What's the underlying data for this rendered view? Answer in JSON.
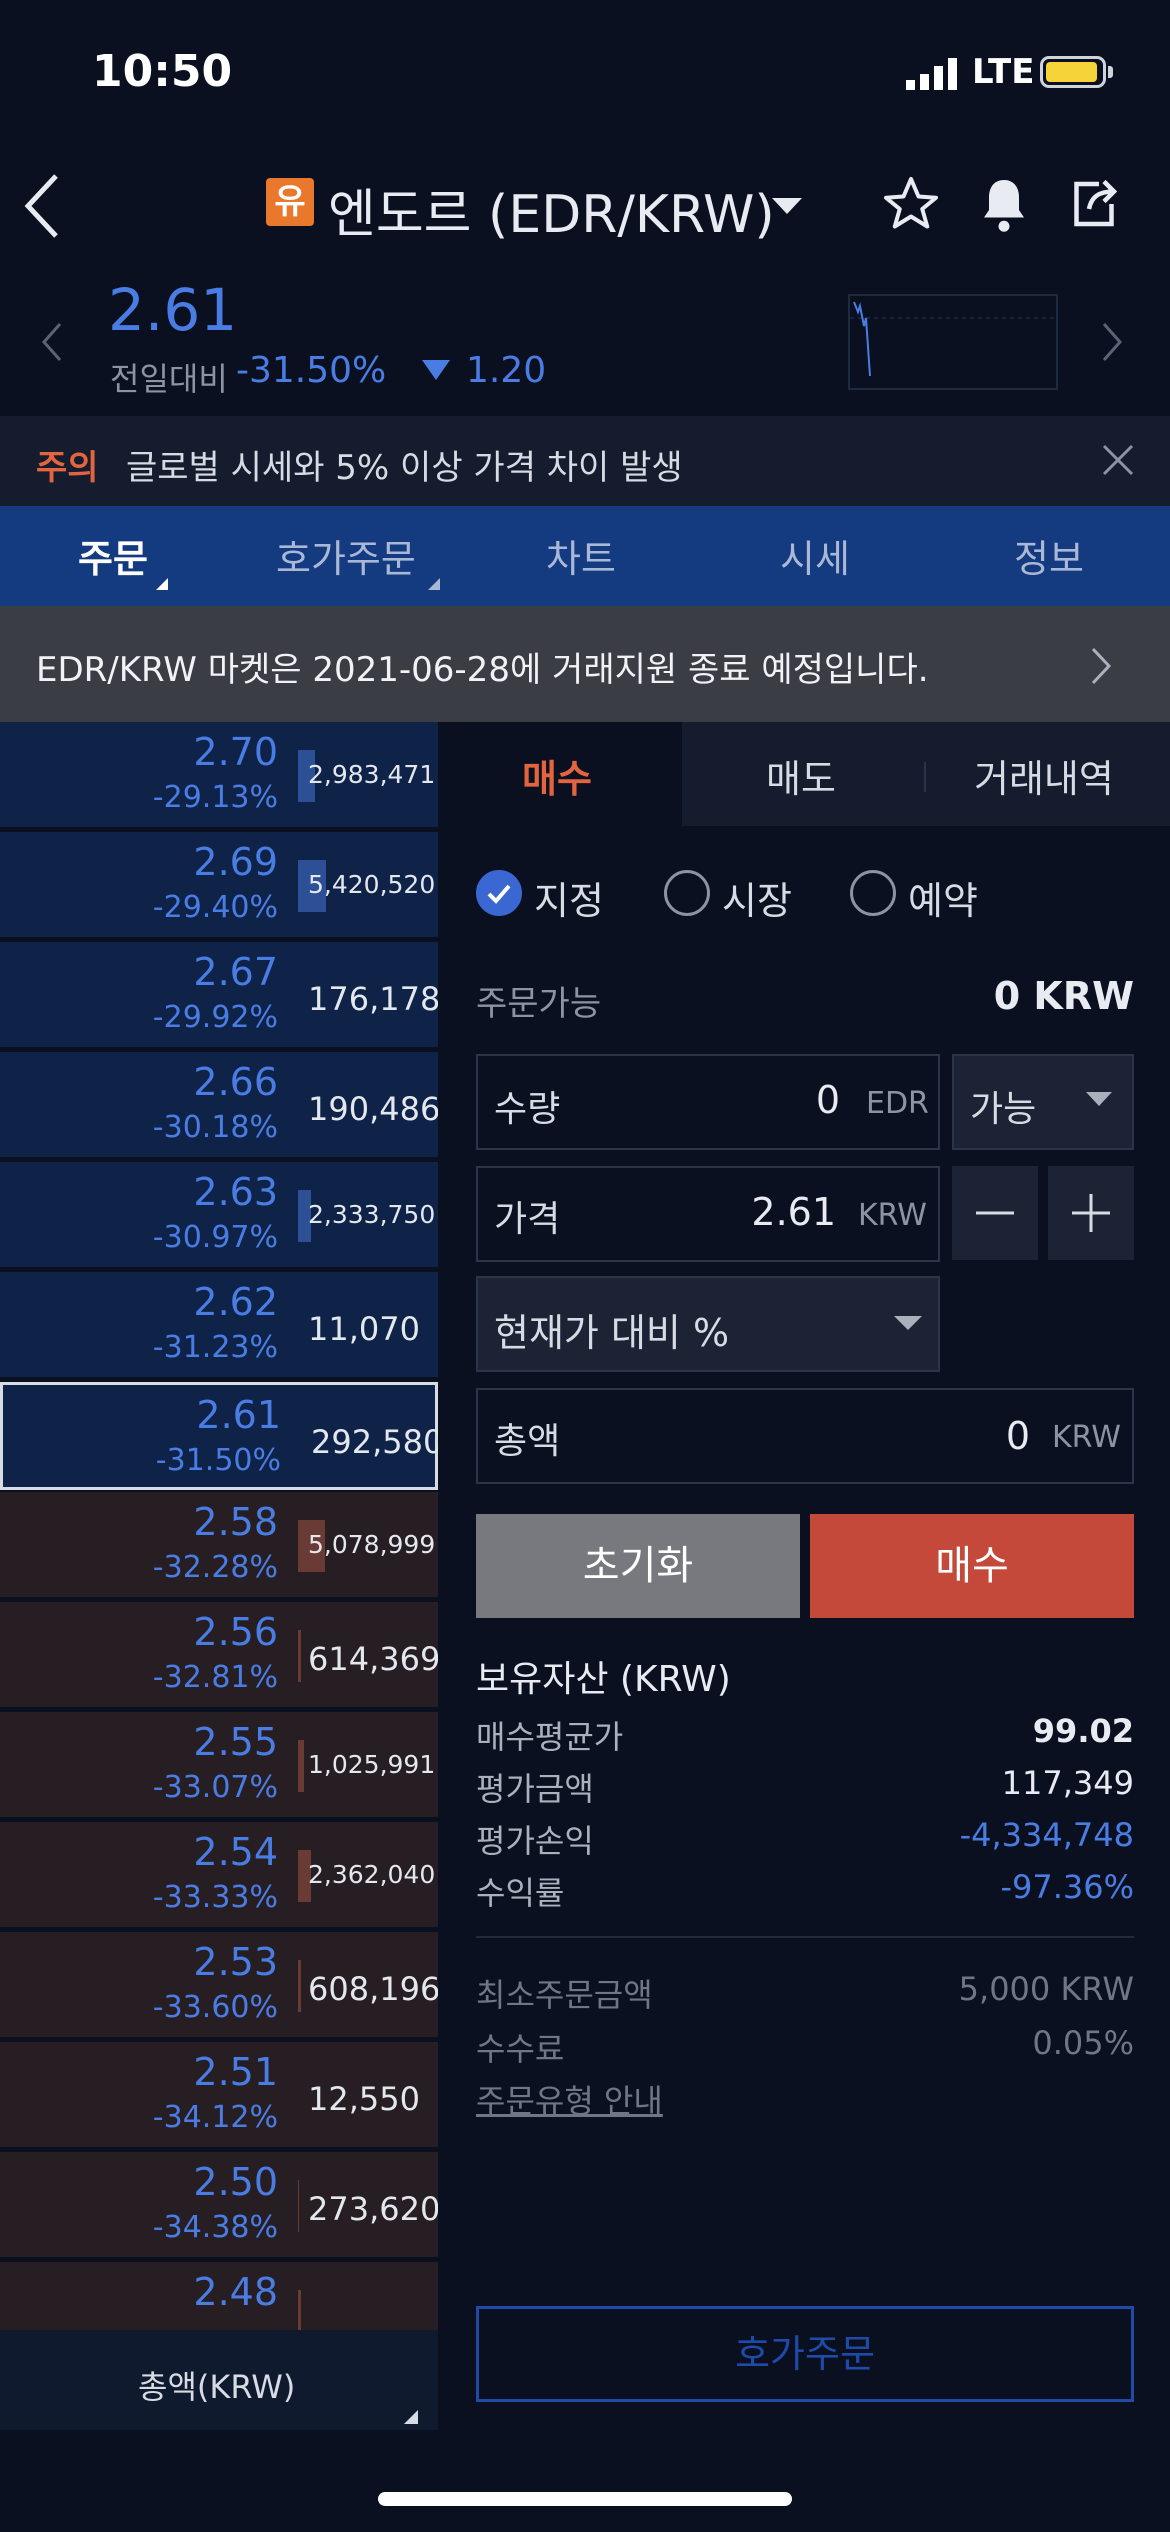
{
  "status_bar": {
    "time": "10:50",
    "network": "LTE"
  },
  "header": {
    "badge": "유",
    "title": "엔도르 (EDR/KRW)"
  },
  "price_bar": {
    "price": "2.61",
    "diff_label": "전일대비",
    "diff_pct": "-31.50%",
    "diff_value": "1.20"
  },
  "notice": {
    "tag": "주의",
    "text": "글로벌 시세와 5% 이상 가격 차이 발생"
  },
  "tabs": [
    {
      "label": "주문",
      "active": true
    },
    {
      "label": "호가주문",
      "active": false
    },
    {
      "label": "차트",
      "active": false
    },
    {
      "label": "시세",
      "active": false
    },
    {
      "label": "정보",
      "active": false
    }
  ],
  "banner": {
    "text": "EDR/KRW 마켓은 2021-06-28에 거래지원 종료 예정입니다."
  },
  "orderbook": {
    "rows": [
      {
        "price": "2.70",
        "pct": "-29.13%",
        "volume": "2,983,471",
        "side": "ask",
        "bar": 0.12
      },
      {
        "price": "2.69",
        "pct": "-29.40%",
        "volume": "5,420,520",
        "side": "ask",
        "bar": 0.2
      },
      {
        "price": "2.67",
        "pct": "-29.92%",
        "volume": "176,178",
        "side": "ask",
        "bar": 0.0
      },
      {
        "price": "2.66",
        "pct": "-30.18%",
        "volume": "190,486",
        "side": "ask",
        "bar": 0.0
      },
      {
        "price": "2.63",
        "pct": "-30.97%",
        "volume": "2,333,750",
        "side": "ask",
        "bar": 0.09
      },
      {
        "price": "2.62",
        "pct": "-31.23%",
        "volume": "11,070",
        "side": "ask",
        "bar": 0.0
      },
      {
        "price": "2.61",
        "pct": "-31.50%",
        "volume": "292,580",
        "side": "ask",
        "bar": 0.0,
        "current": true
      },
      {
        "price": "2.58",
        "pct": "-32.28%",
        "volume": "5,078,999",
        "side": "bid",
        "bar": 0.19
      },
      {
        "price": "2.56",
        "pct": "-32.81%",
        "volume": "614,369",
        "side": "bid",
        "bar": 0.02
      },
      {
        "price": "2.55",
        "pct": "-33.07%",
        "volume": "1,025,991",
        "side": "bid",
        "bar": 0.04
      },
      {
        "price": "2.54",
        "pct": "-33.33%",
        "volume": "2,362,040",
        "side": "bid",
        "bar": 0.09
      },
      {
        "price": "2.53",
        "pct": "-33.60%",
        "volume": "608,196",
        "side": "bid",
        "bar": 0.02
      },
      {
        "price": "2.51",
        "pct": "-34.12%",
        "volume": "12,550",
        "side": "bid",
        "bar": 0.0
      },
      {
        "price": "2.50",
        "pct": "-34.38%",
        "volume": "273,620",
        "side": "bid",
        "bar": 0.01
      },
      {
        "price": "2.48",
        "pct": "",
        "volume": "",
        "side": "bid",
        "bar": 0.02
      }
    ],
    "footer_label": "총액(KRW)"
  },
  "order_panel": {
    "side_tabs": {
      "buy": "매수",
      "sell": "매도",
      "history": "거래내역"
    },
    "order_types": [
      "지정",
      "시장",
      "예약"
    ],
    "available_label": "주문가능",
    "available_value": "0 KRW",
    "qty": {
      "label": "수량",
      "value": "0",
      "unit": "EDR",
      "select": "가능"
    },
    "price": {
      "label": "가격",
      "value": "2.61",
      "unit": "KRW"
    },
    "pct_select": "현재가 대비 %",
    "total": {
      "label": "총액",
      "value": "0",
      "unit": "KRW"
    },
    "reset_label": "초기화",
    "buy_label": "매수",
    "assets_title": "보유자산 (KRW)",
    "assets": [
      {
        "k": "매수평균가",
        "v": "99.02"
      },
      {
        "k": "평가금액",
        "v": "117,349"
      },
      {
        "k": "평가손익",
        "v": "-4,334,748"
      },
      {
        "k": "수익률",
        "v": "-97.36%"
      }
    ],
    "info": [
      {
        "k": "최소주문금액",
        "v": "5,000 KRW"
      },
      {
        "k": "수수료",
        "v": "0.05%"
      }
    ],
    "guide_link": "주문유형 안내",
    "hoga_button": "호가주문"
  },
  "colors": {
    "up": "#e3653f",
    "down": "#4a7de3",
    "tab_bar": "#143a80",
    "buy": "#c4493a"
  }
}
